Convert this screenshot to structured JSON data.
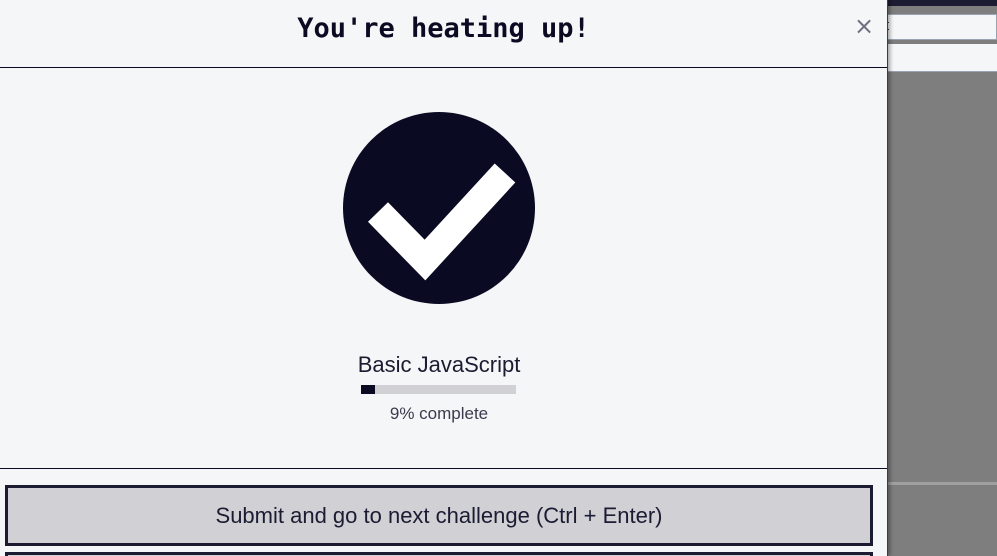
{
  "background": {
    "field_text": "pt"
  },
  "modal": {
    "title": "You're heating up!",
    "close_label": "×",
    "block_title": "Basic JavaScript",
    "progress": {
      "percent": 9,
      "label": "9% complete"
    },
    "submit_label": "Submit and go to next challenge (Ctrl + Enter)"
  },
  "colors": {
    "primary_dark": "#0a0a23",
    "panel_bg": "#f5f6f7",
    "button_bg": "#d0d0d5",
    "overlay": "#7e7e7e"
  },
  "icons": {
    "success": "checkmark-circle-icon",
    "close": "close-icon"
  }
}
